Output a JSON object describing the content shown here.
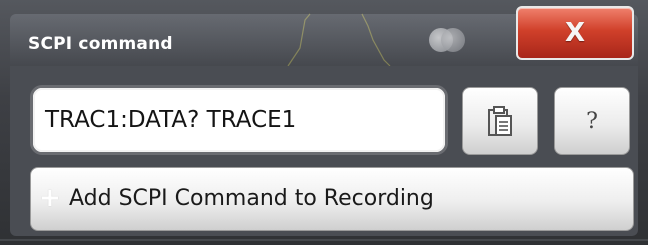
{
  "dialog": {
    "title": "SCPI command",
    "close_label": "X",
    "command_value": "TRAC1:DATA? TRACE1",
    "help_label": "?",
    "add_button_plus": "+",
    "add_button_label": "Add SCPI Command to Recording"
  },
  "icons": {
    "clipboard": "clipboard-icon",
    "help": "question-mark-icon",
    "close": "close-icon",
    "plus": "plus-icon"
  },
  "colors": {
    "close_button": "#d0402a",
    "dialog_background": "#4a4d53",
    "trace_color": "#d6cf5a"
  }
}
